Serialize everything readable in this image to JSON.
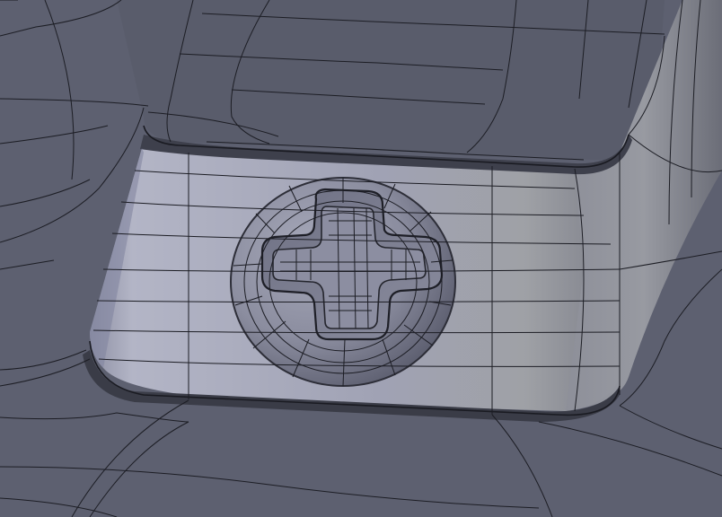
{
  "scene": {
    "subject": "screw-in-recess-wireframe",
    "colors": {
      "background": "#5d6070",
      "upper_surface": "#5a5d6c",
      "wall": "#9a9db0",
      "wall_light": "#a9abbd",
      "floor": "#5b5e6d",
      "screw": "#8d8fa2",
      "screw_recess": "#7a7c8f",
      "edge_dark": "#2c2d36",
      "wire": "#1c1d24"
    }
  }
}
